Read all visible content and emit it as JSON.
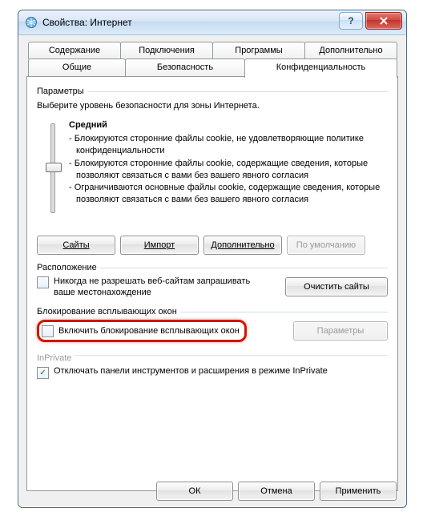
{
  "window": {
    "title": "Свойства: Интернет"
  },
  "tabs": {
    "row1": [
      "Содержание",
      "Подключения",
      "Программы",
      "Дополнительно"
    ],
    "row2": [
      "Общие",
      "Безопасность",
      "Конфиденциальность"
    ],
    "active": "Конфиденциальность"
  },
  "params": {
    "group": "Параметры",
    "desc": "Выберите уровень безопасности для зоны Интернета.",
    "level": "Средний",
    "bullets": [
      "- Блокируются сторонние файлы cookie, не удовлетворяющие политике конфиденциальности",
      "- Блокируются сторонние файлы cookie, содержащие сведения, которые позволяют связаться с вами без вашего явного согласия",
      "- Ограничиваются основные файлы cookie, содержащие сведения, которые позволяют связаться с вами без вашего явного согласия"
    ],
    "buttons": {
      "sites": "Сайты",
      "import": "Импорт",
      "advanced": "Дополнительно",
      "default": "По умолчанию"
    }
  },
  "location": {
    "group": "Расположение",
    "checkbox": "Никогда не разрешать веб-сайтам запрашивать ваше местонахождение",
    "checked": false,
    "clear": "Очистить сайты"
  },
  "popup": {
    "group": "Блокирование всплывающих окон",
    "checkbox": "Включить блокирование всплывающих окон",
    "checked": false,
    "params_btn": "Параметры"
  },
  "inprivate": {
    "group": "InPrivate",
    "checkbox": "Отключать панели инструментов и расширения в режиме InPrivate",
    "checked": true
  },
  "footer": {
    "ok": "ОК",
    "cancel": "Отмена",
    "apply": "Применить"
  },
  "icons": {
    "checkmark": "✓"
  }
}
